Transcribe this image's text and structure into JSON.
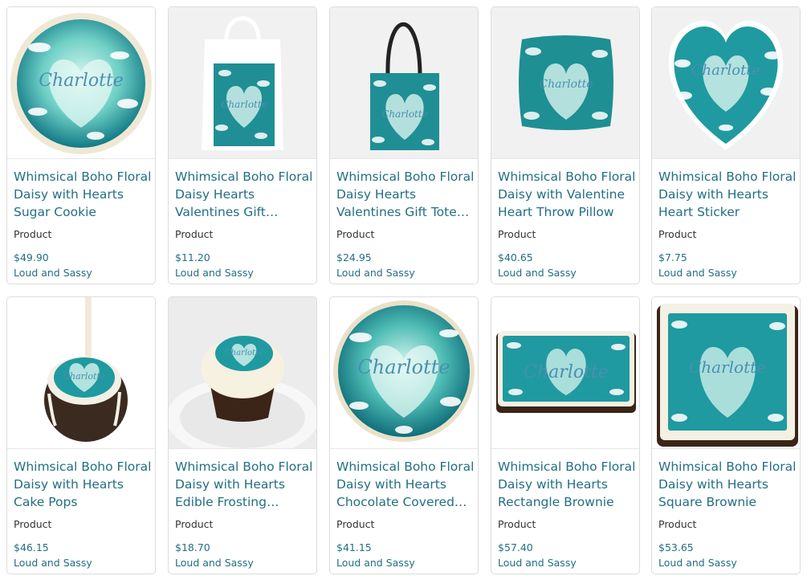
{
  "products": [
    {
      "title": "Whimsical Boho Floral Daisy with Hearts Sugar Cookie",
      "type": "Product",
      "price": "$49.90",
      "seller": "Loud and Sassy",
      "image": "round-cookie",
      "name_on_product": "Charlotte"
    },
    {
      "title": "Whimsical Boho Floral Daisy Hearts Valentines Gift…",
      "type": "Product",
      "price": "$11.20",
      "seller": "Loud and Sassy",
      "image": "white-gift-bag",
      "name_on_product": "Charlotte"
    },
    {
      "title": "Whimsical Boho Floral Daisy Hearts Valentines Gift Tote…",
      "type": "Product",
      "price": "$24.95",
      "seller": "Loud and Sassy",
      "image": "tote-bag-black-handles",
      "name_on_product": "Charlotte"
    },
    {
      "title": "Whimsical Boho Floral Daisy with Valentine Heart Throw Pillow",
      "type": "Product",
      "price": "$40.65",
      "seller": "Loud and Sassy",
      "image": "throw-pillow",
      "name_on_product": "Charlotte"
    },
    {
      "title": "Whimsical Boho Floral Daisy with Hearts Heart Sticker",
      "type": "Product",
      "price": "$7.75",
      "seller": "Loud and Sassy",
      "image": "heart-sticker",
      "name_on_product": "Charlotte"
    },
    {
      "title": "Whimsical Boho Floral Daisy with Hearts Cake Pops",
      "type": "Product",
      "price": "$46.15",
      "seller": "Loud and Sassy",
      "image": "cake-pop",
      "name_on_product": "Charlotte"
    },
    {
      "title": "Whimsical Boho Floral Daisy with Hearts Edible Frosting…",
      "type": "Product",
      "price": "$18.70",
      "seller": "Loud and Sassy",
      "image": "frosted-cupcake",
      "name_on_product": "Charlotte"
    },
    {
      "title": "Whimsical Boho Floral Daisy with Hearts Chocolate Covered…",
      "type": "Product",
      "price": "$41.15",
      "seller": "Loud and Sassy",
      "image": "chocolate-covered-cookie",
      "name_on_product": "Charlotte"
    },
    {
      "title": "Whimsical Boho Floral Daisy with Hearts Rectangle Brownie",
      "type": "Product",
      "price": "$57.40",
      "seller": "Loud and Sassy",
      "image": "rectangle-brownie",
      "name_on_product": "Charlotte"
    },
    {
      "title": "Whimsical Boho Floral Daisy with Hearts Square Brownie",
      "type": "Product",
      "price": "$53.65",
      "seller": "Loud and Sassy",
      "image": "square-brownie",
      "name_on_product": "Charlotte"
    }
  ],
  "colors": {
    "link": "#236f82",
    "text": "#333333",
    "border": "#dcdcdc",
    "teal_art": "#1e8a8e",
    "mint_art": "#bfeee6"
  }
}
